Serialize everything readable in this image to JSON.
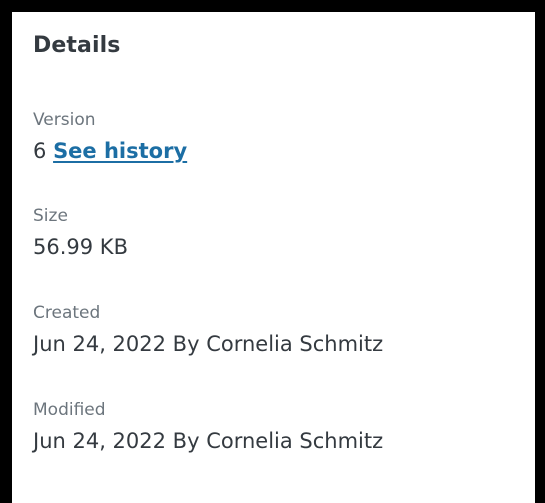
{
  "details": {
    "title": "Details",
    "version": {
      "label": "Version",
      "number": "6",
      "history_link": "See history"
    },
    "size": {
      "label": "Size",
      "value": "56.99 KB"
    },
    "created": {
      "label": "Created",
      "value": "Jun 24, 2022 By Cornelia Schmitz"
    },
    "modified": {
      "label": "Modified",
      "value": "Jun 24, 2022 By Cornelia Schmitz"
    }
  },
  "colors": {
    "text": "#343a40",
    "muted": "#6c757d",
    "link": "#1c6ea4",
    "frame": "#000000"
  }
}
